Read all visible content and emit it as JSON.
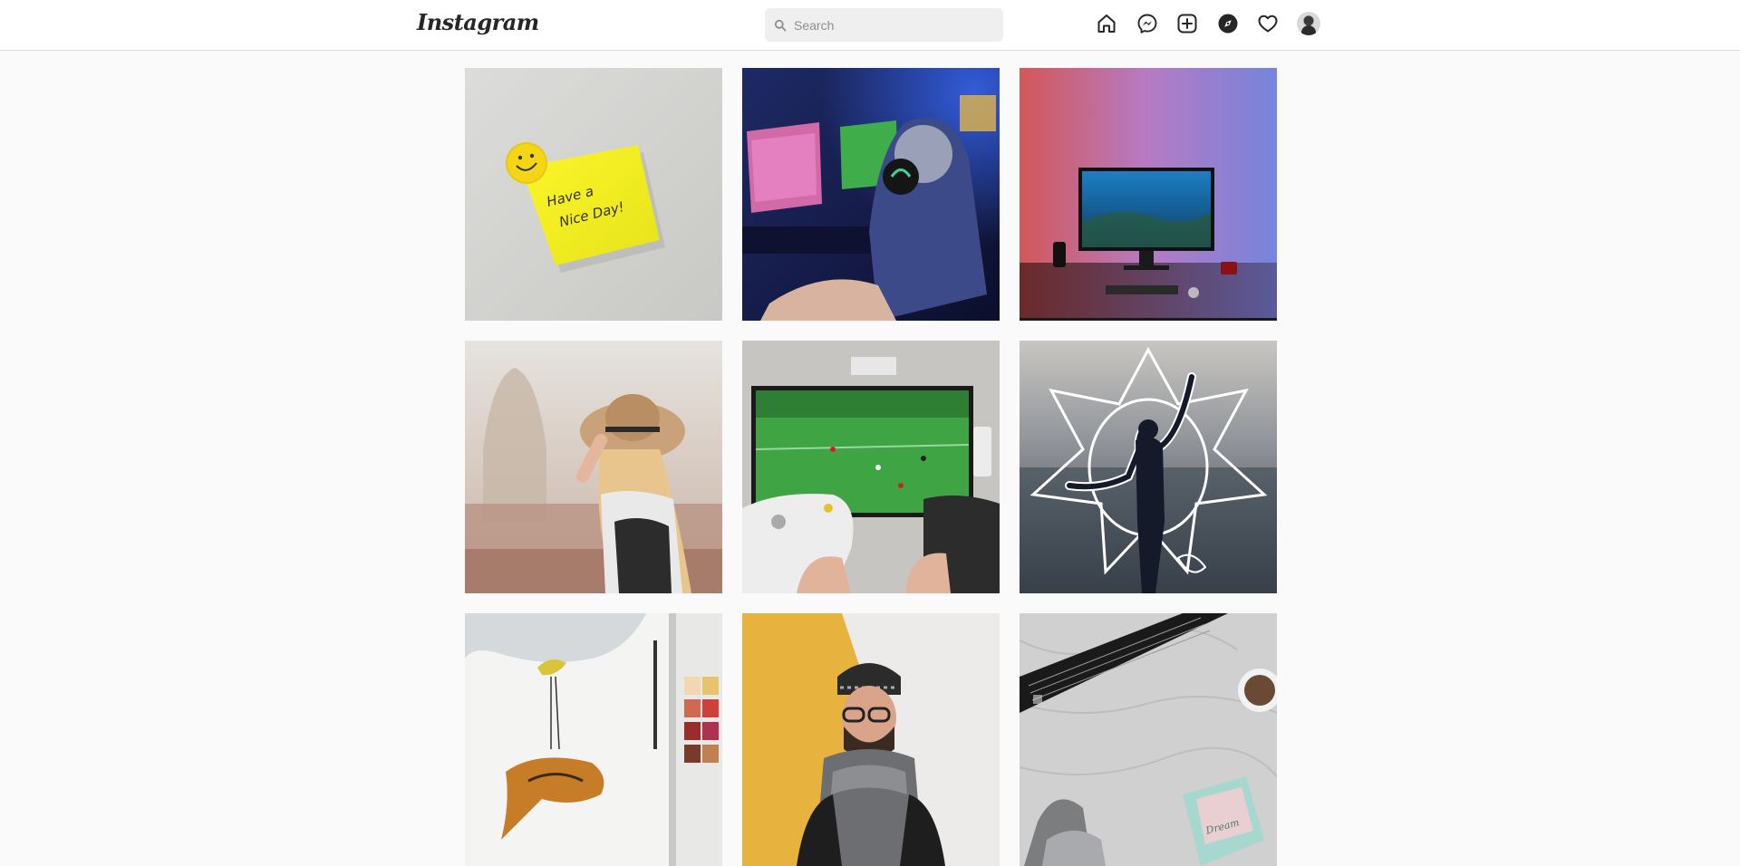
{
  "header": {
    "logo_text": "Instagram",
    "search": {
      "placeholder": "Search",
      "value": ""
    },
    "nav_icons": [
      "home-icon",
      "messenger-icon",
      "new-post-icon",
      "explore-icon",
      "activity-heart-icon",
      "profile-avatar"
    ]
  },
  "grid": {
    "posts": [
      {
        "subject": "sticky-note-smiley",
        "caption_on_image": "Have a Nice Day!"
      },
      {
        "subject": "gamer-with-headset"
      },
      {
        "subject": "desk-monitor-rgb-light"
      },
      {
        "subject": "woman-straw-hat-city"
      },
      {
        "subject": "football-video-game-controllers"
      },
      {
        "subject": "girl-ocean-doodle-art"
      },
      {
        "subject": "watercolor-bird-fox"
      },
      {
        "subject": "man-beanie-glasses-scarf"
      },
      {
        "subject": "guitar-blanket-socks-coffee"
      }
    ]
  },
  "colors": {
    "background": "#fafafa",
    "topbar": "#ffffff",
    "border": "#dbdbdb",
    "search_bg": "#efefef",
    "icon": "#262626"
  }
}
